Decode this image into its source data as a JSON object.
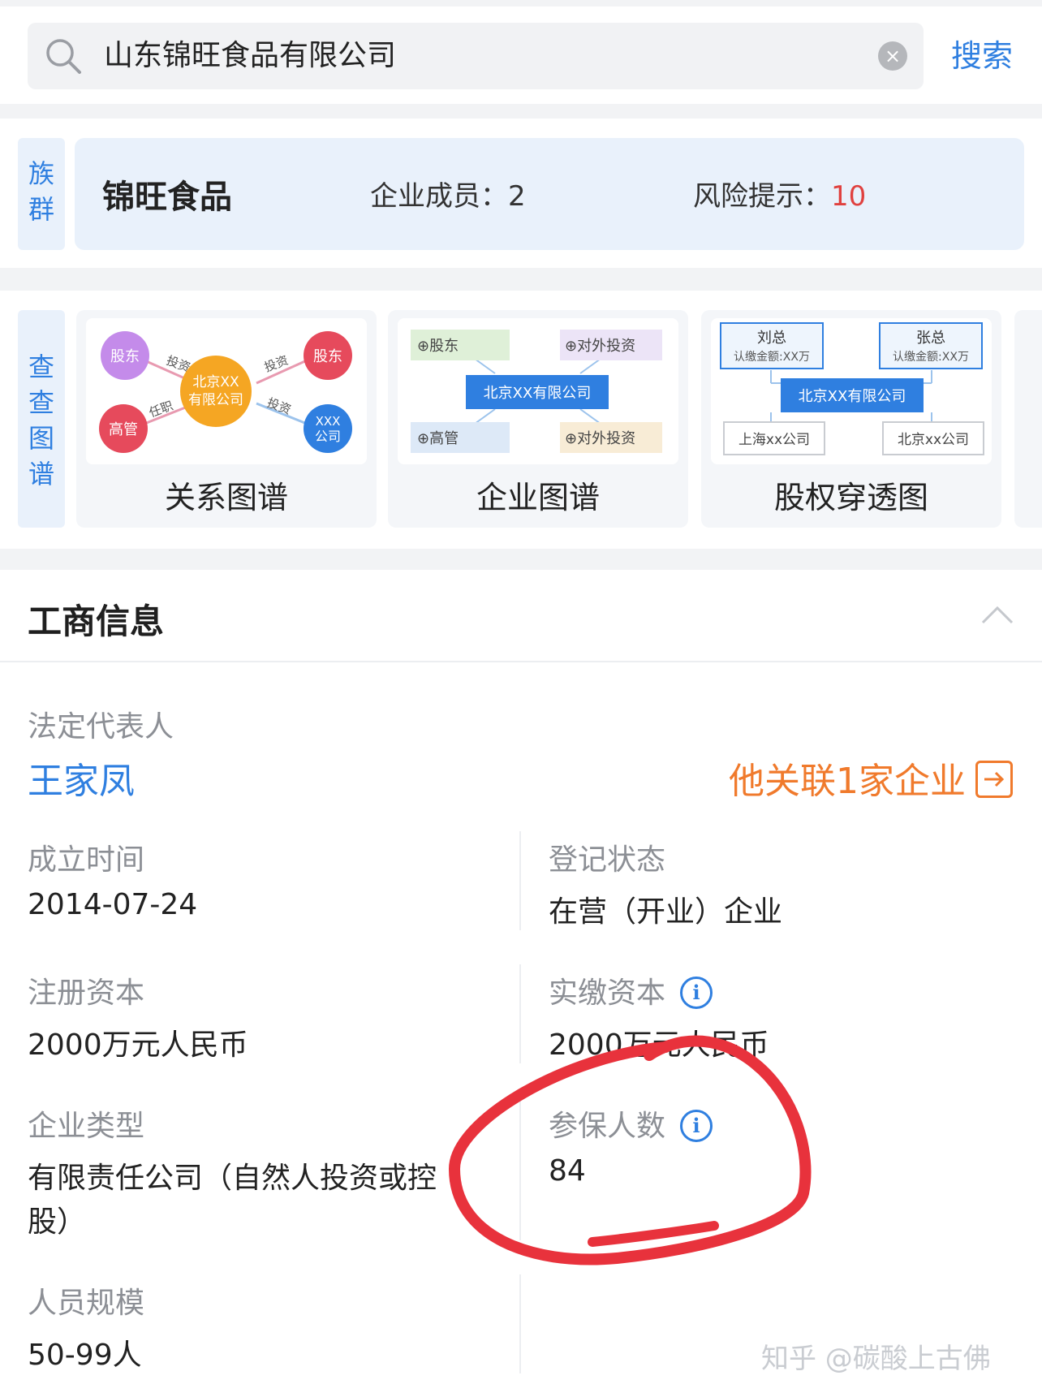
{
  "search": {
    "value": "山东锦旺食品有限公司",
    "button_label": "搜索",
    "clear_icon": "×"
  },
  "group": {
    "tag_chars": [
      "族",
      "群"
    ],
    "name": "锦旺食品",
    "members_label": "企业成员：",
    "members_count": "2",
    "risk_label": "风险提示：",
    "risk_count": "10"
  },
  "graphs": {
    "tag_chars": [
      "查",
      "查",
      "图",
      "谱"
    ],
    "items": [
      {
        "label": "关系图谱",
        "nodes": {
          "shareholder_left": "股东",
          "shareholder_right": "股东",
          "center_1": "北京XX",
          "center_2": "有限公司",
          "executive": "高管",
          "company_1": "XXX",
          "company_2": "公司"
        },
        "edges": {
          "invest_left": "投资",
          "invest_right": "投资",
          "serve": "任职",
          "invest_bottom": "投资"
        }
      },
      {
        "label": "企业图谱",
        "nodes": {
          "shareholder": "⊕股东",
          "outbound_top": "⊕对外投资",
          "center": "北京XX有限公司",
          "executive": "⊕高管",
          "outbound_bottom": "⊕对外投资"
        }
      },
      {
        "label": "股权穿透图",
        "nodes": {
          "p1_name": "刘总",
          "p1_amount": "认缴金额:XX万",
          "p2_name": "张总",
          "p2_amount": "认缴金额:XX万",
          "center": "北京XX有限公司",
          "child_1": "上海xx公司",
          "child_2": "北京xx公司"
        }
      }
    ]
  },
  "business_info": {
    "title": "工商信息",
    "legal_rep_label": "法定代表人",
    "legal_rep_name": "王家凤",
    "linked_text": "他关联1家企业",
    "fields": {
      "founded_label": "成立时间",
      "founded_value": "2014-07-24",
      "status_label": "登记状态",
      "status_value": "在营（开业）企业",
      "reg_capital_label": "注册资本",
      "reg_capital_value": "2000万元人民币",
      "paid_capital_label": "实缴资本",
      "paid_capital_value": "2000万元人民币",
      "company_type_label": "企业类型",
      "company_type_value_line1": "有限责任公司（自然人投资或控",
      "company_type_value_line2": "股）",
      "insured_label": "参保人数",
      "insured_value": "84",
      "staff_size_label": "人员规模",
      "staff_size_value": "50-99人"
    }
  },
  "watermark": "知乎 @碳酸上古佛",
  "colors": {
    "accent": "#2f7fe0",
    "risk": "#e0413f",
    "link_orange": "#f07a2c",
    "annotation_red": "#e8323c"
  }
}
